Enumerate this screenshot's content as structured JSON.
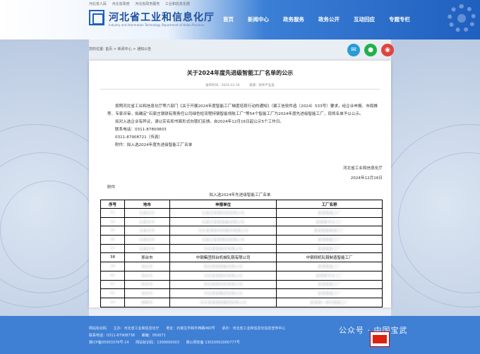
{
  "header": {
    "toplinks": [
      "河北省人民",
      "河北省政府",
      "河北省政务服务",
      "工业和信息化部"
    ],
    "site_title": "河北省工业和信息化厅",
    "site_subtitle": "Industry and Information Technology Department of Hebei Province",
    "nav": [
      "首页",
      "新闻中心",
      "政务服务",
      "政务公开",
      "互动回应",
      "专题专栏"
    ]
  },
  "breadcrumb": {
    "label": "您的位置:",
    "items": [
      "首页",
      "新闻中心",
      "通知公告"
    ]
  },
  "share": {
    "weibo_color": "#e0443d",
    "wechat_color": "#22b14c",
    "weibo2_color": "#e0443d"
  },
  "article": {
    "title": "关于2024年度先进级智能工厂名单的公示",
    "meta_time": "发布时间：2024-12-16",
    "meta_source": "来源：软件产业处",
    "paragraphs": [
      "按照河北省工业和信息化厅等六部门《关于开展2024年度智能工厂梯度培育行动的通知》（冀工信软件函〔2024〕533号）要求，经企业申报、市局推荐、专家评审，拟确定“石家庄钢铁有限责任公司绿色短流程特钢智能领航工厂”等54个智能工厂为2024年度先进级智能工厂，现将名单予以公示。",
      "如对入选企业有异议，请以实名和书面形式向我们反馈。自2024年12月16日起公示5个工作日。"
    ],
    "contacts": [
      "联系电话：0311-87800803",
      "0311-87908721（传真）"
    ],
    "attachment_line": "附件：拟入选2024年度先进级智能工厂名单",
    "signature_org": "河北省工业和信息化厅",
    "signature_date": "2024年12月16日",
    "attachment_label": "附件",
    "table_title": "拟入选2024年先进级智能工厂名单",
    "table_headers": [
      "序号",
      "地市",
      "申报单位",
      "工厂名称"
    ],
    "rows_top": [
      [
        "33",
        "石家庄市",
        "石家庄某某科技有限公司",
        "某某智能工厂"
      ],
      [
        "34",
        "石家庄市",
        "石家庄某某装备有限公司",
        "某某数字化工厂"
      ],
      [
        "35",
        "石家庄市",
        "河北某某新材料股份有限公司",
        "某某智能制造工厂"
      ],
      [
        "36",
        "石家庄市",
        "石家庄某某食品有限公司",
        "某某智能工厂"
      ],
      [
        "37",
        "石家庄市",
        "河北某某医药有限公司",
        "某某智能工厂"
      ]
    ],
    "row_selected": [
      "38",
      "邢台市",
      "中钢集团邢台机械轧辊有限公司",
      "中钢邢机轧辊制造智能工厂"
    ],
    "rows_bottom": [
      [
        "39",
        "邢台市",
        "邢台某某装备有限公司",
        "某某智能工厂"
      ],
      [
        "40",
        "邢台市",
        "河北某某股份有限公司",
        "某某数字化工厂"
      ],
      [
        "41",
        "邢台市",
        "邢台某某科技有限公司",
        "某某智能工厂"
      ],
      [
        "42",
        "邢台市",
        "河北某某集团有限公司",
        "某某智能工厂"
      ],
      [
        "43",
        "邯郸市",
        "河北某某钢铁集团有限公司",
        "某某钢一体化智能工厂"
      ]
    ]
  },
  "footer": {
    "row1": [
      "网站标识码",
      "主办：河北省工业和信息化厅",
      "地址：石家庄市和平西路460号",
      "承办：河北省工业和信息化信息宣传中心"
    ],
    "row2": [
      "联系电话：0311-87908738",
      "邮编：050071"
    ],
    "row3": [
      "冀ICP备05003376号-14",
      "网站标识码：1300000003",
      "冀公网安备 13010502000777号"
    ],
    "watermark": "公众号 · 中国宝武"
  }
}
